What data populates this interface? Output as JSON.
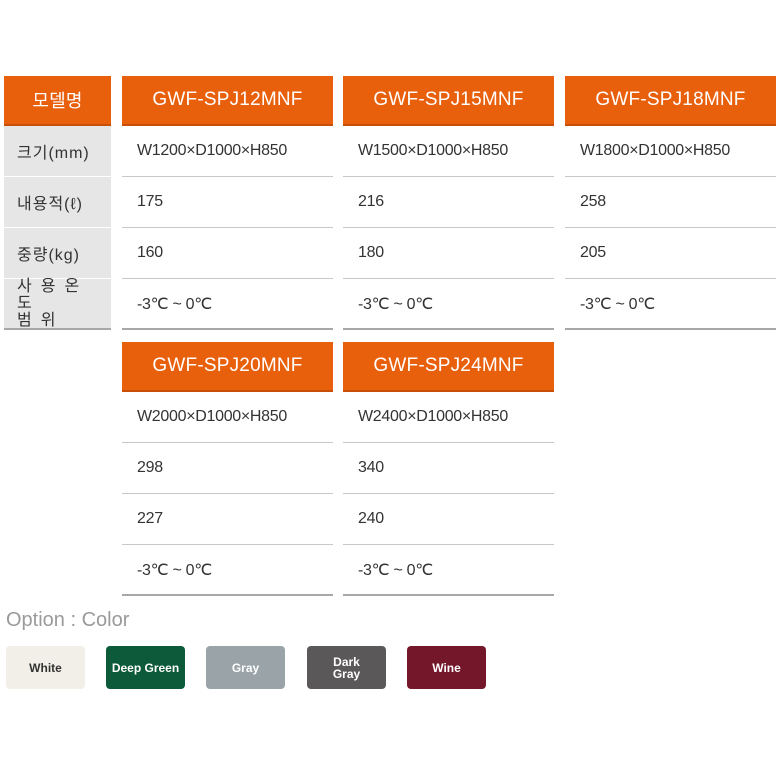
{
  "labels": {
    "header": "모델명",
    "size": "크기(mm)",
    "volume": "내용적(ℓ)",
    "weight": "중량(kg)",
    "temp_line1": "사용온도",
    "temp_line2": "범위"
  },
  "models": [
    {
      "name": "GWF-SPJ12MNF",
      "size": "W1200×D1000×H850",
      "volume": "175",
      "weight": "160",
      "temp": "-3℃ ~ 0℃"
    },
    {
      "name": "GWF-SPJ15MNF",
      "size": "W1500×D1000×H850",
      "volume": "216",
      "weight": "180",
      "temp": "-3℃ ~ 0℃"
    },
    {
      "name": "GWF-SPJ18MNF",
      "size": "W1800×D1000×H850",
      "volume": "258",
      "weight": "205",
      "temp": "-3℃ ~ 0℃"
    },
    {
      "name": "GWF-SPJ20MNF",
      "size": "W2000×D1000×H850",
      "volume": "298",
      "weight": "227",
      "temp": "-3℃ ~ 0℃"
    },
    {
      "name": "GWF-SPJ24MNF",
      "size": "W2400×D1000×H850",
      "volume": "340",
      "weight": "240",
      "temp": "-3℃ ~ 0℃"
    }
  ],
  "option": {
    "title": "Option : Color",
    "colors": [
      {
        "label": "White",
        "bg": "#f2efe8",
        "fg": "#333333"
      },
      {
        "label": "Deep Green",
        "bg": "#0d5a3a",
        "fg": "#ffffff"
      },
      {
        "label": "Gray",
        "bg": "#9aa4a8",
        "fg": "#ffffff"
      },
      {
        "label": "Dark Gray",
        "bg": "#5a5858",
        "fg": "#ffffff"
      },
      {
        "label": "Wine",
        "bg": "#75172b",
        "fg": "#ffffff"
      }
    ]
  }
}
